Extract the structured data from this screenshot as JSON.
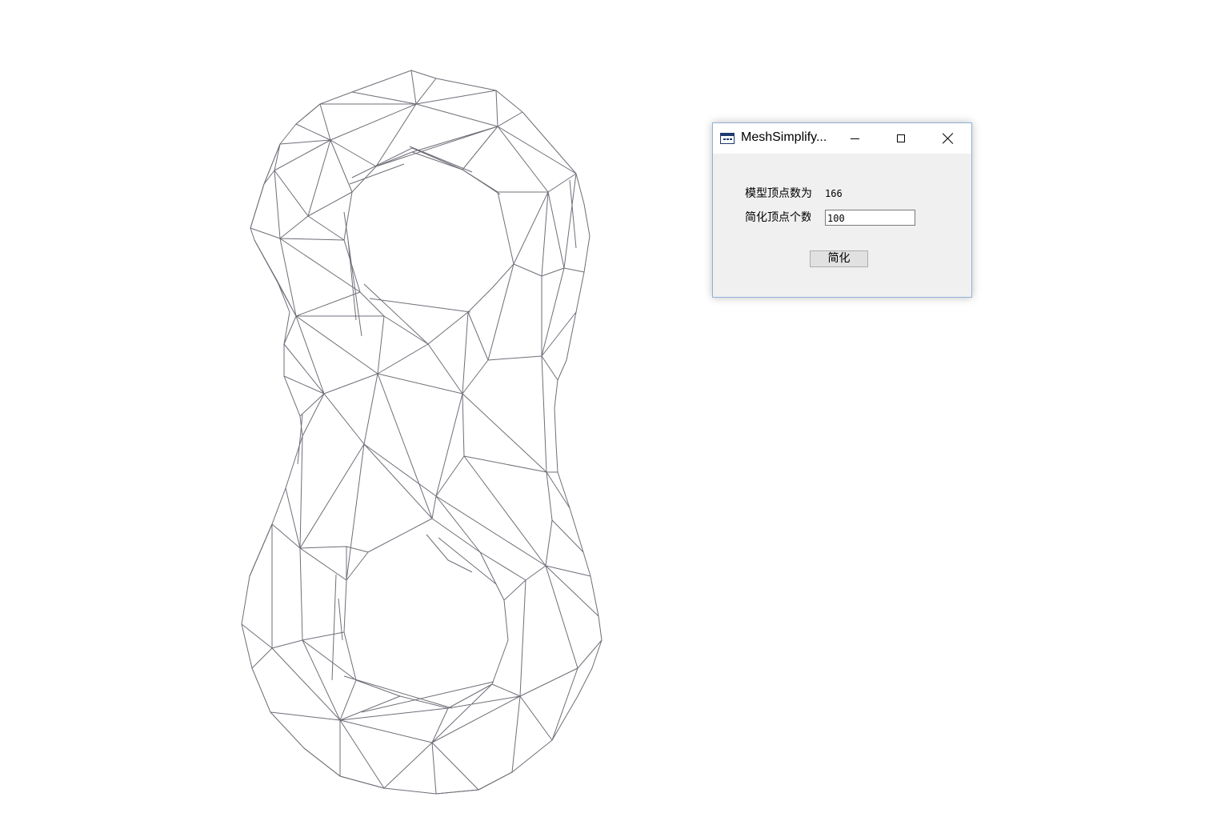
{
  "dialog": {
    "title": "MeshSimplify...",
    "vertex_count_label": "模型顶点数为",
    "vertex_count_value": "166",
    "target_label": "简化顶点个数",
    "target_value": "100",
    "simplify_button": "简化",
    "icons": {
      "app": "window-app-icon",
      "minimize": "minimize-icon",
      "maximize": "maximize-icon",
      "close": "close-icon"
    }
  },
  "mesh": {
    "stroke_color": "#6e6e78",
    "background_color": "#ffffff"
  }
}
